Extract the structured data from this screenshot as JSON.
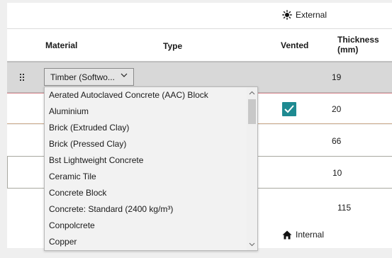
{
  "external_label": "External",
  "internal_label": "Internal",
  "header": {
    "material": "Material",
    "type": "Type",
    "vented": "Vented",
    "thickness_line1": "Thickness",
    "thickness_line2": "(mm)"
  },
  "rows": [
    {
      "material": "Timber (Softwo...",
      "thickness": "19",
      "vented": false,
      "selected": true
    },
    {
      "material": "",
      "thickness": "20",
      "vented": true
    },
    {
      "material": "",
      "thickness": "66",
      "vented": false
    },
    {
      "material": "",
      "thickness": "10",
      "vented": false
    },
    {
      "material": "",
      "thickness": "115",
      "vented": false
    }
  ],
  "dropdown_options": [
    "Aerated Autoclaved Concrete (AAC) Block",
    "Aluminium",
    "Brick (Extruded Clay)",
    "Brick (Pressed Clay)",
    "Bst Lightweight Concrete",
    "Ceramic Tile",
    "Concrete Block",
    "Concrete: Standard (2400 kg/m³)",
    "Conpolcrete",
    "Copper"
  ],
  "colors": {
    "checkbox": "#1e8a91",
    "selected_row": "#d8d8d8",
    "row2_border": "#d98a92"
  },
  "icons": {
    "external": "sun-icon",
    "internal": "house-icon",
    "drag": "drag-handle-icon",
    "combo": "chevron-down-icon"
  }
}
